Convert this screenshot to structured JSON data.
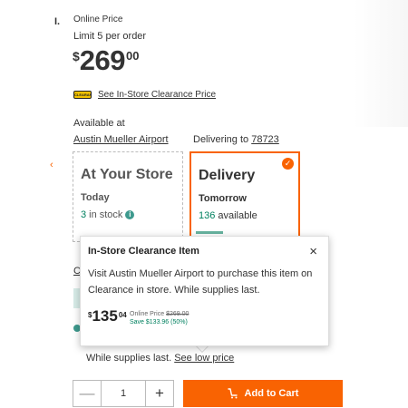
{
  "edge": {
    "mark": "I.",
    "chevron": "‹"
  },
  "pricing": {
    "online_label": "Online Price",
    "limit_text": "Limit 5 per order",
    "currency": "$",
    "dollars": "269",
    "cents": "00"
  },
  "clearance": {
    "tag_text": "CLEARANCE",
    "link_text": "See In-Store Clearance Price"
  },
  "availability": {
    "label": "Available at",
    "store_name": "Austin Mueller Airport",
    "delivering_prefix": "Delivering to",
    "zip": "78723"
  },
  "store_card": {
    "title": "At Your Store",
    "subtitle": "Today",
    "stock_count": "3",
    "stock_suffix": "in stock",
    "info_icon": "info-icon"
  },
  "delivery_card": {
    "title": "Delivery",
    "subtitle": "Tomorrow",
    "available_count": "136",
    "available_suffix": "available",
    "selected": true
  },
  "background_peek": {
    "letter": "C"
  },
  "popover": {
    "title": "In-Store Clearance Item",
    "close": "×",
    "body": "Visit Austin Mueller Airport to purchase this item on Clearance in store. While supplies last.",
    "currency": "$",
    "dollars": "135",
    "cents": "04",
    "online_prefix": "Online Price",
    "online_original": "$269.00",
    "savings": "Save $133.96 (50%)"
  },
  "supplies": {
    "text": "While supplies last.",
    "link": "See low price"
  },
  "cart": {
    "quantity": "1",
    "minus": "—",
    "plus": "+",
    "add_label": "Add to Cart"
  },
  "colors": {
    "brand_orange": "#f96302",
    "stock_green": "#00805f",
    "teal_info": "#3e9a8e",
    "clearance_yellow": "#f2c200"
  }
}
